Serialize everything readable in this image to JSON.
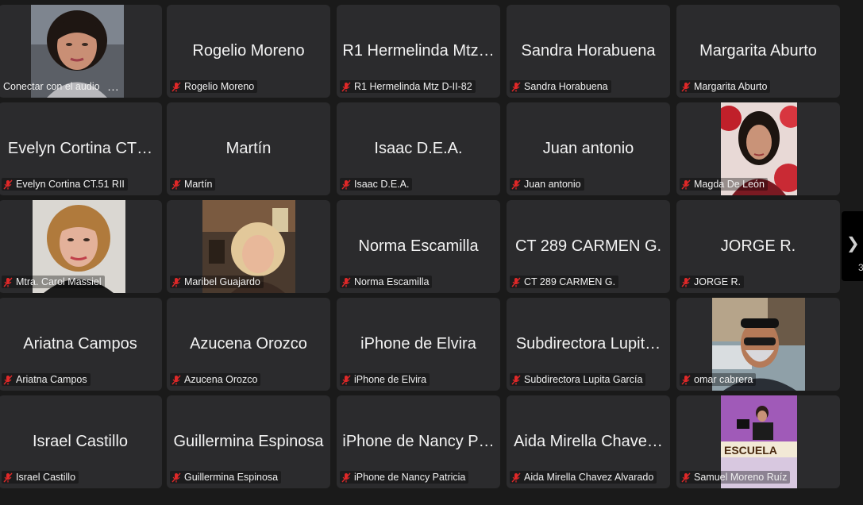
{
  "tiles": [
    {
      "id": "t1",
      "big": "",
      "label": "Conectar con el audio",
      "muted": false,
      "has_video": true,
      "video": "woman-dark-hair",
      "more": "..."
    },
    {
      "id": "t2",
      "big": "Rogelio Moreno",
      "label": "Rogelio Moreno",
      "muted": true
    },
    {
      "id": "t3",
      "big": "R1 Hermelinda Mtz…",
      "label": "R1 Hermelinda Mtz D-II-82",
      "muted": true
    },
    {
      "id": "t4",
      "big": "Sandra Horabuena",
      "label": "Sandra Horabuena",
      "muted": true
    },
    {
      "id": "t5",
      "big": "Margarita Aburto",
      "label": "Margarita Aburto",
      "muted": true
    },
    {
      "id": "t6",
      "big": "Evelyn Cortina CT…",
      "label": "Evelyn Cortina CT.51 RII",
      "muted": true
    },
    {
      "id": "t7",
      "big": "Martín",
      "label": "Martín",
      "muted": true
    },
    {
      "id": "t8",
      "big": "Isaac D.E.A.",
      "label": "Isaac D.E.A.",
      "muted": true
    },
    {
      "id": "t9",
      "big": "Juan antonio",
      "label": "Juan antonio",
      "muted": true
    },
    {
      "id": "t10",
      "big": "",
      "label": "Magda De León",
      "muted": true,
      "has_video": true,
      "video": "woman-red-background"
    },
    {
      "id": "t11",
      "big": "",
      "label": "Mtra. Carol Massiel",
      "muted": true,
      "has_video": true,
      "video": "woman-blonde"
    },
    {
      "id": "t12",
      "big": "",
      "label": "Maribel Guajardo",
      "muted": true,
      "has_video": true,
      "video": "woman-restaurant"
    },
    {
      "id": "t13",
      "big": "Norma Escamilla",
      "label": "Norma Escamilla",
      "muted": true
    },
    {
      "id": "t14",
      "big": "CT 289 CARMEN G.",
      "label": "CT 289 CARMEN G.",
      "muted": true
    },
    {
      "id": "t15",
      "big": "JORGE R.",
      "label": "JORGE R.",
      "muted": true
    },
    {
      "id": "t16",
      "big": "Ariatna Campos",
      "label": "Ariatna Campos",
      "muted": true
    },
    {
      "id": "t17",
      "big": "Azucena Orozco",
      "label": "Azucena Orozco",
      "muted": true
    },
    {
      "id": "t18",
      "big": "iPhone de Elvira",
      "label": "iPhone de Elvira",
      "muted": true
    },
    {
      "id": "t19",
      "big": "Subdirectora Lupit…",
      "label": "Subdirectora Lupita García",
      "muted": true
    },
    {
      "id": "t20",
      "big": "",
      "label": "omar cabrera",
      "muted": true,
      "has_video": true,
      "video": "man-mask"
    },
    {
      "id": "t21",
      "big": "Israel Castillo",
      "label": "Israel Castillo",
      "muted": true
    },
    {
      "id": "t22",
      "big": "Guillermina Espinosa",
      "label": "Guillermina Espinosa",
      "muted": true
    },
    {
      "id": "t23",
      "big": "iPhone de Nancy P…",
      "label": "iPhone de Nancy Patricia",
      "muted": true
    },
    {
      "id": "t24",
      "big": "Aida Mirella Chave…",
      "label": "Aida Mirella Chavez Alvarado",
      "muted": true
    },
    {
      "id": "t25",
      "big": "",
      "label": "Samuel Moreno Ruíz",
      "muted": true,
      "has_video": true,
      "video": "escuela-tv",
      "video_text": "ESCUELA"
    }
  ],
  "side_panel": {
    "count": "3"
  },
  "colors": {
    "tile_bg": "#2b2b2d",
    "page_bg": "#1a1a1a",
    "mute_red": "#e02828"
  }
}
